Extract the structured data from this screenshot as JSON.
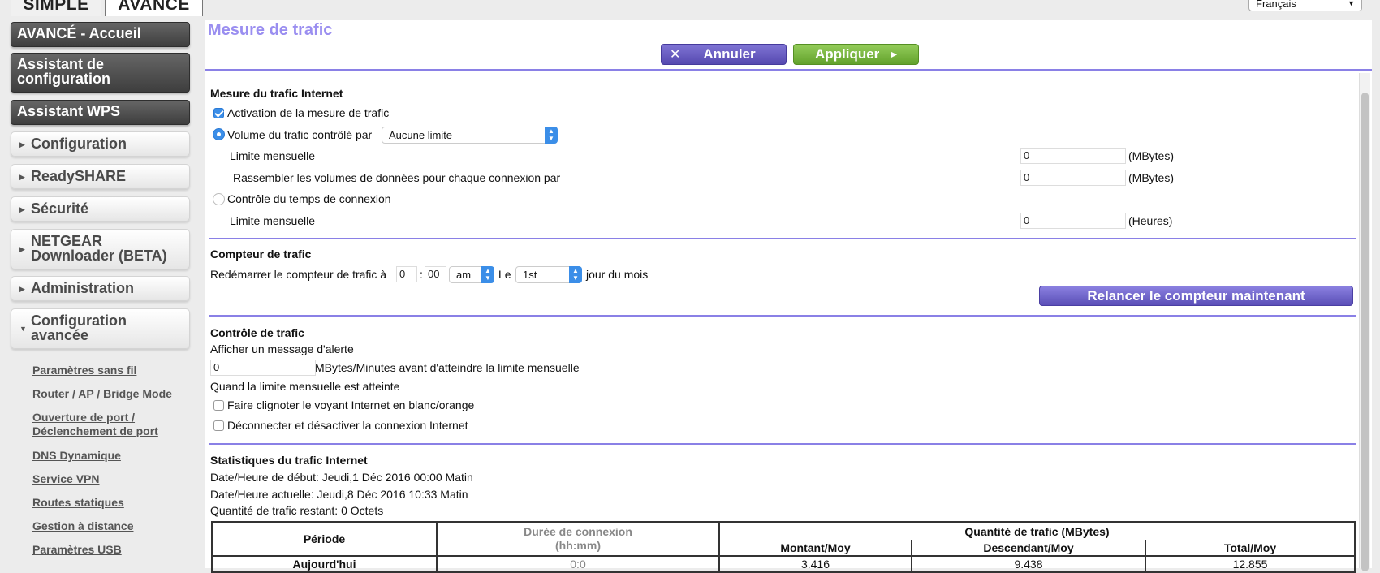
{
  "tabs": {
    "simple": "SIMPLE",
    "avance": "AVANCÉ"
  },
  "language": {
    "selected": "Français"
  },
  "sidebar": {
    "dark_items": [
      "AVANCÉ - Accueil",
      "Assistant de configuration",
      "Assistant WPS"
    ],
    "light_items": [
      "Configuration",
      "ReadySHARE",
      "Sécurité",
      "NETGEAR Downloader (BETA)",
      "Administration",
      "Configuration avancée"
    ],
    "sub_items": [
      "Paramètres sans fil",
      "Router / AP / Bridge Mode",
      "Ouverture de port / Déclenchement de port",
      "DNS Dynamique",
      "Service VPN",
      "Routes statiques",
      "Gestion à distance",
      "Paramètres USB"
    ]
  },
  "page": {
    "title": "Mesure de trafic",
    "cancel_label": "Annuler",
    "apply_label": "Appliquer"
  },
  "internet_traffic": {
    "heading": "Mesure du trafic Internet",
    "enable_label": "Activation de la mesure de trafic",
    "enable_checked": true,
    "volume_label": "Volume du trafic contrôlé par",
    "volume_selected": "Aucune limite",
    "monthly_limit_label": "Limite mensuelle",
    "monthly_limit_value": "0",
    "monthly_limit_unit": "(MBytes)",
    "round_up_label": "Rassembler les volumes de données pour chaque connexion par",
    "round_up_value": "0",
    "round_up_unit": "(MBytes)",
    "time_label": "Contrôle du temps de connexion",
    "time_limit_label": "Limite mensuelle",
    "time_limit_value": "0",
    "time_limit_unit": "(Heures)"
  },
  "counter": {
    "heading": "Compteur de trafic",
    "restart_label": "Redémarrer le compteur de trafic à",
    "hour": "0",
    "colon": ":",
    "minute": "00",
    "ampm": "am",
    "le_label": "Le",
    "day": "1st",
    "day_suffix": "jour du mois",
    "reset_label": "Relancer le compteur maintenant"
  },
  "control": {
    "heading": "Contrôle de trafic",
    "alert_label": "Afficher un message d'alerte",
    "alert_value": "0",
    "alert_suffix": "MBytes/Minutes avant d'atteindre la limite mensuelle",
    "reached_label": "Quand la limite mensuelle est atteinte",
    "blink_label": "Faire clignoter le voyant Internet en blanc/orange",
    "disconnect_label": "Déconnecter et désactiver la connexion Internet"
  },
  "stats": {
    "heading": "Statistiques du trafic Internet",
    "start_date": "Date/Heure de début: Jeudi,1 Déc 2016 00:00 Matin",
    "current_date": "Date/Heure actuelle: Jeudi,8 Déc 2016 10:33 Matin",
    "remaining": "Quantité de trafic restant: 0 Octets",
    "table": {
      "col_period": "Période",
      "col_duration_1": "Durée de connexion",
      "col_duration_2": "(hh:mm)",
      "col_quantity": "Quantité de trafic (MBytes)",
      "col_up": "Montant/Moy",
      "col_down": "Descendant/Moy",
      "col_total": "Total/Moy",
      "rows": [
        {
          "period": "Aujourd'hui",
          "duration": "0:0",
          "up": "3.416",
          "down": "9.438",
          "total": "12.855"
        }
      ]
    }
  }
}
